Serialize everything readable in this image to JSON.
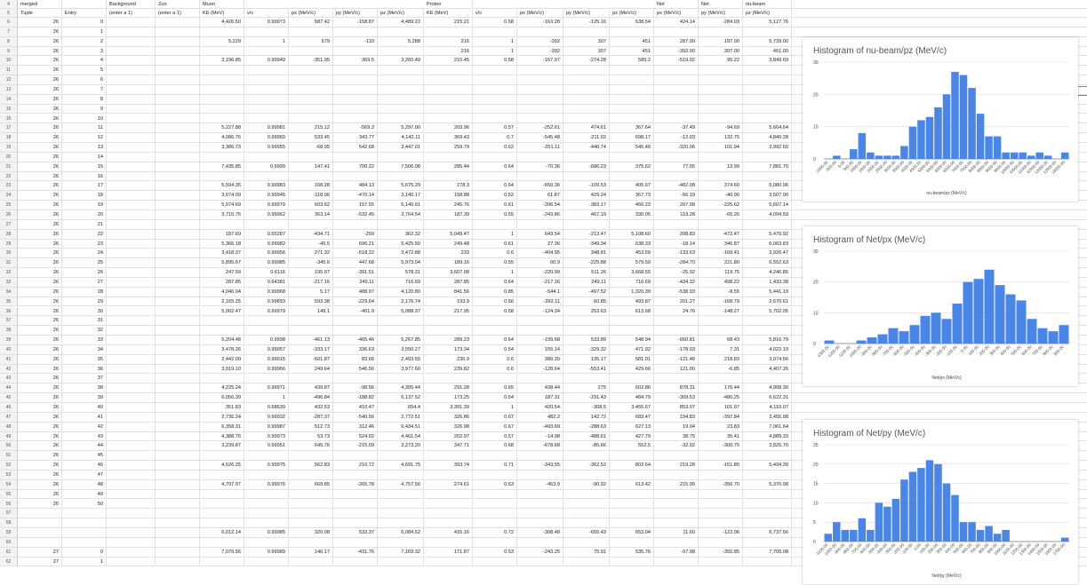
{
  "header1": {
    "col1": "merged",
    "col3": "Background",
    "col4": "Zoo",
    "col5": "Muon",
    "col11": "Proton",
    "col17": "Net",
    "col18": "Net",
    "col19": "nu-beam"
  },
  "header2": {
    "col1": "Tuple",
    "col2": "Entry",
    "col3": "(enter a 1)",
    "col4": "(enter a 1)",
    "col5": "KE (MeV)",
    "col6": "v/c",
    "col7": "px (MeV/c)",
    "col8": "py (MeV/c)",
    "col9": "pz (MeV/c)",
    "col10": "KE (MeV)",
    "col11": "v/c",
    "col12": "px (MeV/c)",
    "col13": "py (MeV/c)",
    "col14": "pz (MeV/c)",
    "col15": "px (MeV/c)",
    "col16": "py (MeV/c)",
    "col17": "pz (MeV/c)"
  },
  "rownums": [
    "4",
    "5",
    "6",
    "7",
    "8",
    "9",
    "10",
    "11",
    "12",
    "13",
    "14",
    "15",
    "16",
    "17",
    "18",
    "19",
    "20",
    "21",
    "22",
    "23",
    "24",
    "25",
    "26",
    "27",
    "28",
    "29",
    "30",
    "31",
    "32",
    "33",
    "34",
    "35",
    "36",
    "37",
    "38",
    "39",
    "40",
    "41",
    "42",
    "43",
    "44",
    "45",
    "46",
    "47",
    "48",
    "49",
    "50",
    "51",
    "52",
    "53",
    "54",
    "55",
    "56",
    "57",
    "58",
    "59",
    "60",
    "61",
    "62"
  ],
  "rows": [
    [
      "26",
      "0",
      "",
      "",
      "4,426.50",
      "0.99973",
      "587.42",
      "-158.87",
      "4,489.22",
      "215.21",
      "0.58",
      "-163.28",
      "-125.16",
      "638.54",
      "424.14",
      "-284.03",
      "5,127.76"
    ],
    [
      "26",
      "1",
      "",
      "",
      "",
      "",
      "",
      "",
      "",
      "",
      "",
      "",
      "",
      "",
      "",
      "",
      ""
    ],
    [
      "26",
      "2",
      "",
      "",
      "5,229",
      "1",
      "679",
      "-110",
      "5,288",
      "216",
      "1",
      "-392",
      "307",
      "451",
      "287.00",
      "197.00",
      "5,739.00"
    ],
    [
      "26",
      "3",
      "",
      "",
      "",
      "",
      "",
      "",
      "",
      "216",
      "1",
      "-392",
      "307",
      "451",
      "-392.00",
      "307.00",
      "451.00"
    ],
    [
      "26",
      "4",
      "",
      "",
      "3,196.85",
      "0.99949",
      "-351.95",
      "369.5",
      "3,260.49",
      "215.45",
      "0.58",
      "-167.97",
      "-274.28",
      "589.2",
      "-519.92",
      "95.22",
      "3,849.69"
    ],
    [
      "26",
      "5",
      "",
      "",
      "",
      "",
      "",
      "",
      "",
      "",
      "",
      "",
      "",
      "",
      "",
      "",
      ""
    ],
    [
      "26",
      "6",
      "",
      "",
      "",
      "",
      "",
      "",
      "",
      "",
      "",
      "",
      "",
      "",
      "",
      "",
      ""
    ],
    [
      "26",
      "7",
      "",
      "",
      "",
      "",
      "",
      "",
      "",
      "",
      "",
      "",
      "",
      "",
      "",
      "",
      ""
    ],
    [
      "26",
      "8",
      "",
      "",
      "",
      "",
      "",
      "",
      "",
      "",
      "",
      "",
      "",
      "",
      "",
      "",
      ""
    ],
    [
      "26",
      "9",
      "",
      "",
      "",
      "",
      "",
      "",
      "",
      "",
      "",
      "",
      "",
      "",
      "",
      "",
      ""
    ],
    [
      "26",
      "10",
      "",
      "",
      "",
      "",
      "",
      "",
      "",
      "",
      "",
      "",
      "",
      "",
      "",
      "",
      ""
    ],
    [
      "26",
      "11",
      "",
      "",
      "5,227.88",
      "0.99981",
      "215.12",
      "-569.3",
      "5,297.00",
      "203.96",
      "0.57",
      "-252.61",
      "474.61",
      "367.64",
      "-37.49",
      "-94.69",
      "5,664.64"
    ],
    [
      "26",
      "12",
      "",
      "",
      "4,086.76",
      "0.99969",
      "533.45",
      "343.77",
      "4,142.11",
      "369.43",
      "0.7",
      "-545.48",
      "-211.02",
      "698.17",
      "-12.03",
      "132.75",
      "4,840.28"
    ],
    [
      "26",
      "13",
      "",
      "",
      "3,386.73",
      "0.99955",
      "-68.95",
      "542.68",
      "3,447.01",
      "259.79",
      "0.62",
      "-251.11",
      "-440.74",
      "545.49",
      "-320.06",
      "101.94",
      "3,992.50"
    ],
    [
      "26",
      "14",
      "",
      "",
      "",
      "",
      "",
      "",
      "",
      "",
      "",
      "",
      "",
      "",
      "",
      "",
      ""
    ],
    [
      "26",
      "15",
      "",
      "",
      "7,435.85",
      "0.9999",
      "147.41",
      "700.22",
      "7,506.08",
      "285.44",
      "0.64",
      "-70.36",
      "-686.23",
      "375.62",
      "77.05",
      "13.99",
      "7,881.70"
    ],
    [
      "26",
      "16",
      "",
      "",
      "",
      "",
      "",
      "",
      "",
      "",
      "",
      "",
      "",
      "",
      "",
      "",
      ""
    ],
    [
      "26",
      "17",
      "",
      "",
      "5,594.35",
      "0.99983",
      "168.28",
      "484.13",
      "5,675.29",
      "278.3",
      "0.64",
      "-650.36",
      "-109.53",
      "405.67",
      "-482.08",
      "374.60",
      "6,080.96"
    ],
    [
      "26",
      "18",
      "",
      "",
      "3,074.09",
      "0.99945",
      "-118.06",
      "-470.14",
      "3,140.17",
      "158.88",
      "0.52",
      "61.87",
      "429.24",
      "367.73",
      "-56.19",
      "-40.90",
      "3,507.90"
    ],
    [
      "26",
      "19",
      "",
      "",
      "5,074.69",
      "0.99979",
      "603.62",
      "157.55",
      "5,140.91",
      "245.76",
      "0.61",
      "-396.54",
      "-383.17",
      "466.23",
      "207.08",
      "-225.62",
      "5,607.14"
    ],
    [
      "26",
      "20",
      "",
      "",
      "3,715.75",
      "0.99962",
      "363.14",
      "-532.45",
      "3,764.54",
      "187.39",
      "0.55",
      "-243.86",
      "467.19",
      "330.05",
      "119.28",
      "-65.26",
      "4,094.59"
    ],
    [
      "26",
      "21",
      "",
      "",
      "",
      "",
      "",
      "",
      "",
      "",
      "",
      "",
      "",
      "",
      "",
      "",
      ""
    ],
    [
      "26",
      "22",
      "",
      "",
      "187.69",
      "0.55287",
      "-434.71",
      "-259",
      "362.32",
      "5,049.47",
      "1",
      "643.54",
      "-213.47",
      "5,108.60",
      "208.83",
      "-472.47",
      "5,470.92"
    ],
    [
      "26",
      "23",
      "",
      "",
      "5,366.18",
      "0.99982",
      "-45.5",
      "696.21",
      "5,425.50",
      "249.48",
      "0.61",
      "27.36",
      "-349.34",
      "638.33",
      "-18.14",
      "346.87",
      "6,063.83"
    ],
    [
      "26",
      "24",
      "",
      "",
      "3,418.37",
      "0.99956",
      "271.32",
      "-518.22",
      "3,472.88",
      "233",
      "0.6",
      "-404.95",
      "348.81",
      "453.59",
      "-133.63",
      "-169.41",
      "3,926.47"
    ],
    [
      "26",
      "25",
      "",
      "",
      "5,895.67",
      "0.99985",
      "-345.6",
      "447.68",
      "5,973.04",
      "189.16",
      "0.55",
      "60.9",
      "-225.88",
      "579.59",
      "-284.70",
      "221.80",
      "6,552.63"
    ],
    [
      "26",
      "26",
      "",
      "",
      "247.59",
      "0.6116",
      "195.07",
      "-391.51",
      "578.31",
      "3,607.08",
      "1",
      "-220.99",
      "511.26",
      "3,668.55",
      "-25.92",
      "119.75",
      "4,246.86"
    ],
    [
      "26",
      "27",
      "",
      "",
      "287.85",
      "0.64381",
      "-217.16",
      "249.11",
      "716.69",
      "287.85",
      "0.64",
      "-217.16",
      "249.11",
      "716.69",
      "-434.32",
      "498.22",
      "1,433.38"
    ],
    [
      "26",
      "28",
      "",
      "",
      "4,046.04",
      "0.99968",
      "5.17",
      "488.97",
      "4,120.80",
      "841.56",
      "0.85",
      "-544.1",
      "-497.52",
      "1,320.39",
      "-538.93",
      "-8.55",
      "5,441.19"
    ],
    [
      "26",
      "29",
      "",
      "",
      "2,165.25",
      "0.99893",
      "593.38",
      "-229.64",
      "2,176.74",
      "193.9",
      "0.56",
      "-392.11",
      "60.85",
      "493.87",
      "201.27",
      "-168.79",
      "2,670.61"
    ],
    [
      "26",
      "30",
      "",
      "",
      "5,002.47",
      "0.99979",
      "149.1",
      "-401.9",
      "5,088.37",
      "217.95",
      "0.58",
      "-124.34",
      "253.63",
      "613.68",
      "24.76",
      "-148.27",
      "5,702.05"
    ],
    [
      "26",
      "31",
      "",
      "",
      "",
      "",
      "",
      "",
      "",
      "",
      "",
      "",
      "",
      "",
      "",
      "",
      ""
    ],
    [
      "26",
      "32",
      "",
      "",
      "",
      "",
      "",
      "",
      "",
      "",
      "",
      "",
      "",
      "",
      "",
      "",
      ""
    ],
    [
      "26",
      "33",
      "",
      "",
      "5,204.48",
      "0.9998",
      "-461.13",
      "-465.46",
      "5,267.85",
      "289.23",
      "0.64",
      "-199.68",
      "533.89",
      "548.94",
      "-660.81",
      "68.43",
      "5,816.79"
    ],
    [
      "26",
      "34",
      "",
      "",
      "3,478.26",
      "0.99957",
      "-333.17",
      "336.63",
      "3,550.27",
      "173.34",
      "0.54",
      "155.14",
      "-329.32",
      "471.92",
      "-178.03",
      "7.31",
      "4,022.19"
    ],
    [
      "26",
      "35",
      "",
      "",
      "2,442.09",
      "0.99915",
      "-501.87",
      "83.66",
      "2,493.55",
      "236.9",
      "0.6",
      "380.39",
      "135.17",
      "581.01",
      "-121.48",
      "218.83",
      "3,074.56"
    ],
    [
      "26",
      "36",
      "",
      "",
      "3,919.10",
      "0.99966",
      "249.64",
      "546.56",
      "3,977.60",
      "239.82",
      "0.6",
      "-128.64",
      "-553.41",
      "429.66",
      "121.00",
      "-6.85",
      "4,407.26"
    ],
    [
      "26",
      "37",
      "",
      "",
      "",
      "",
      "",
      "",
      "",
      "",
      "",
      "",
      "",
      "",
      "",
      "",
      ""
    ],
    [
      "26",
      "38",
      "",
      "",
      "4,225.24",
      "0.99971",
      "439.87",
      "-98.56",
      "4,305.44",
      "291.28",
      "0.65",
      "438.44",
      "275",
      "602.86",
      "878.31",
      "176.44",
      "4,908.30"
    ],
    [
      "26",
      "39",
      "",
      "",
      "6,056.39",
      "1",
      "-496.84",
      "-188.82",
      "6,137.52",
      "173.25",
      "0.54",
      "187.31",
      "-291.43",
      "484.79",
      "-309.53",
      "-480.25",
      "6,622.31"
    ],
    [
      "26",
      "40",
      "",
      "",
      "351.83",
      "0.68639",
      "432.53",
      "410.47",
      "654.4",
      "3,391.39",
      "1",
      "420.54",
      "-308.5",
      "3,455.67",
      "853.07",
      "101.97",
      "4,110.07"
    ],
    [
      "26",
      "41",
      "",
      "",
      "2,736.24",
      "0.99932",
      "-287.37",
      "-540.56",
      "2,772.51",
      "326.86",
      "0.67",
      "482.2",
      "142.72",
      "683.47",
      "194.83",
      "-397.84",
      "3,455.98"
    ],
    [
      "26",
      "42",
      "",
      "",
      "6,358.31",
      "0.99987",
      "512.73",
      "312.46",
      "6,434.51",
      "326.98",
      "0.67",
      "-493.69",
      "-288.63",
      "627.13",
      "19.04",
      "23.83",
      "7,061.64"
    ],
    [
      "26",
      "43",
      "",
      "",
      "4,388.76",
      "0.99973",
      "53.73",
      "524.02",
      "4,461.54",
      "202.97",
      "0.57",
      "-14.98",
      "-488.61",
      "427.79",
      "38.75",
      "35.41",
      "4,889.33"
    ],
    [
      "26",
      "44",
      "",
      "",
      "3,239.87",
      "0.99951",
      "645.76",
      "-215.09",
      "3,273.20",
      "347.71",
      "0.68",
      "-678.68",
      "-85.66",
      "552.5",
      "-32.92",
      "-300.75",
      "3,825.70"
    ],
    [
      "26",
      "45",
      "",
      "",
      "",
      "",
      "",
      "",
      "",
      "",
      "",
      "",
      "",
      "",
      "",
      "",
      ""
    ],
    [
      "26",
      "46",
      "",
      "",
      "4,626.25",
      "0.99975",
      "562.83",
      "210.72",
      "4,691.75",
      "393.74",
      "0.71",
      "-343.55",
      "-362.52",
      "802.64",
      "219.28",
      "-151.80",
      "5,494.39"
    ],
    [
      "26",
      "47",
      "",
      "",
      "",
      "",
      "",
      "",
      "",
      "",
      "",
      "",
      "",
      "",
      "",
      "",
      ""
    ],
    [
      "26",
      "48",
      "",
      "",
      "4,707.97",
      "0.99976",
      "669.85",
      "-265.78",
      "4,757.56",
      "274.61",
      "0.63",
      "-453.9",
      "-90.92",
      "613.42",
      "215.95",
      "-356.70",
      "5,370.98"
    ],
    [
      "26",
      "49",
      "",
      "",
      "",
      "",
      "",
      "",
      "",
      "",
      "",
      "",
      "",
      "",
      "",
      "",
      ""
    ],
    [
      "26",
      "50",
      "",
      "",
      "",
      "",
      "",
      "",
      "",
      "",
      "",
      "",
      "",
      "",
      "",
      "",
      ""
    ],
    [
      "",
      "",
      "",
      "",
      "",
      "",
      "",
      "",
      "",
      "",
      "",
      "",
      "",
      "",
      "",
      "",
      ""
    ],
    [
      "",
      "",
      "",
      "",
      "",
      "",
      "",
      "",
      "",
      "",
      "",
      "",
      "",
      "",
      "",
      "",
      ""
    ],
    [
      "",
      "",
      "",
      "",
      "6,012.14",
      "0.99985",
      "320.08",
      "533.37",
      "6,084.52",
      "415.16",
      "0.72",
      "-308.48",
      "-655.43",
      "653.04",
      "11.60",
      "-122.06",
      "6,737.56"
    ],
    [
      "",
      "",
      "",
      "",
      "",
      "",
      "",
      "",
      "",
      "",
      "",
      "",
      "",
      "",
      "",
      "",
      ""
    ],
    [
      "27",
      "0",
      "",
      "",
      "7,079.56",
      "0.99989",
      "146.17",
      "-431.76",
      "7,169.32",
      "171.87",
      "0.53",
      "-243.25",
      "75.91",
      "535.76",
      "-97.08",
      "-355.85",
      "7,705.08"
    ],
    [
      "27",
      "1",
      "",
      "",
      "",
      "",
      "",
      "",
      "",
      "",
      "",
      "",
      "",
      "",
      "",
      "",
      ""
    ]
  ],
  "chart_data": [
    {
      "type": "bar",
      "title": "Histogram of nu-beam/pz (MeV/c)",
      "xlabel": "nu-beam/pz (MeV/c)",
      "ylim": [
        0,
        30
      ],
      "yticks": [
        0,
        10,
        20,
        30
      ],
      "categories": [
        "-1000.00",
        "-500.00",
        "0.00",
        "500.00",
        "1000.00",
        "1500.00",
        "2000.00",
        "2500.00",
        "3000.00",
        "3500.00",
        "4000.00",
        "4500.00",
        "5000.00",
        "5500.00",
        "6000.00",
        "6500.00",
        "7000.00",
        "7500.00",
        "8000.00",
        "8500.00",
        "9000.00",
        "9500.00",
        "10000.00",
        "10500.00",
        "11000.00",
        "11500.00",
        "12000.00",
        "12500.00",
        "13000.00"
      ],
      "values": [
        0,
        1,
        0,
        3,
        8,
        2,
        1,
        1,
        1,
        4,
        10,
        12,
        13,
        16,
        20,
        27,
        26,
        22,
        14,
        7,
        7,
        2,
        2,
        2,
        1,
        2,
        1,
        0,
        2
      ],
      "color": "#4a86e8"
    },
    {
      "type": "bar",
      "title": "Histogram of Net/px (MeV/c)",
      "xlabel": "Net/px (MeV/c)",
      "ylim": [
        0,
        30
      ],
      "yticks": [
        0,
        10,
        20,
        30
      ],
      "categories": [
        "-1300.00",
        "-1200.00",
        "-1100.00",
        "-1000.00",
        "-900.00",
        "-800.00",
        "-700.00",
        "-600.00",
        "-500.00",
        "-400.00",
        "-300.00",
        "-200.00",
        "-100.00",
        "0.00",
        "100.00",
        "200.00",
        "300.00",
        "400.00",
        "500.00",
        "600.00",
        "700.00",
        "800.00",
        "900.00"
      ],
      "values": [
        1,
        0,
        0,
        1,
        2,
        3,
        5,
        4,
        6,
        9,
        10,
        8,
        13,
        20,
        21,
        24,
        19,
        16,
        14,
        8,
        5,
        4,
        6
      ],
      "color": "#4a86e8"
    },
    {
      "type": "bar",
      "title": "Histogram of Net/py (MeV/c)",
      "xlabel": "Net/py (MeV/c)",
      "ylim": [
        0,
        25
      ],
      "yticks": [
        0,
        5,
        10,
        15,
        20,
        25
      ],
      "categories": [
        "-1100.00",
        "-1000.00",
        "-900.00",
        "-800.00",
        "-700.00",
        "-600.00",
        "-500.00",
        "-400.00",
        "-300.00",
        "-200.00",
        "-100.00",
        "0.00",
        "100.00",
        "200.00",
        "300.00",
        "400.00",
        "500.00",
        "600.00",
        "700.00",
        "800.00",
        "900.00",
        "1000.00",
        "1100.00",
        "1200.00",
        "1300.00",
        "1400.00",
        "1500.00",
        "1600.00",
        "1700.00"
      ],
      "values": [
        2,
        5,
        3,
        3,
        6,
        3,
        10,
        9,
        11,
        16,
        18,
        19,
        21,
        20,
        15,
        12,
        5,
        5,
        3,
        4,
        2,
        3,
        0,
        0,
        0,
        0,
        0,
        0,
        1
      ],
      "color": "#4a86e8"
    }
  ]
}
